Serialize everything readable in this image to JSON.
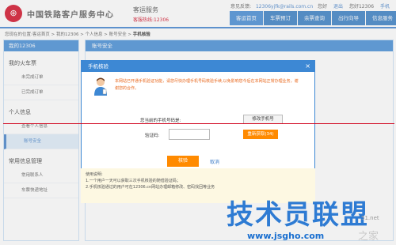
{
  "header": {
    "logo_char": "⊕",
    "brand": "中国铁路客户服务中心",
    "sub_title": "客运服务",
    "hotline": "客服热线:12306",
    "feedback_label": "意见反馈:",
    "email": "12306yjfk@rails.com.cn",
    "welcome": "您好",
    "logout": "退出",
    "greeting_suffix": "您好12306",
    "mobile": "手机"
  },
  "nav": [
    "客运首页",
    "车票预订",
    "余票查询",
    "出行向导",
    "信息服务"
  ],
  "breadcrumb": {
    "prefix": "您现在的位置:客运首页 > 我的12306 > 个人信息 > 账号安全 > ",
    "current": "手机核验"
  },
  "sidebar": {
    "title": "我的12306",
    "groups": [
      {
        "label": "我的火车票",
        "items": [
          {
            "label": "未完成订单"
          },
          {
            "label": "已完成订单"
          }
        ]
      },
      {
        "label": "个人信息",
        "items": [
          {
            "label": "查看个人信息"
          },
          {
            "label": "账号安全"
          }
        ]
      },
      {
        "label": "常用信息管理",
        "items": [
          {
            "label": "常用联系人"
          },
          {
            "label": "车票快递地址"
          }
        ]
      }
    ]
  },
  "main": {
    "title": "账号安全"
  },
  "dialog": {
    "title": "手机核验",
    "close": "×",
    "notice": "本网站已开通手机验证功能，请您尽快办理手机号码核验手续,以免影响您今后在本网站正常办理业务，谢谢您的合作。",
    "phone_label": "您当前的手机号码是:",
    "phone_value": "",
    "modify_button": "修改手机号",
    "code_label": "验证码:",
    "code_value": "",
    "resend_button": "重新获取(34)",
    "confirm_button": "核验",
    "cancel_link": "取消"
  },
  "help": {
    "title": "使用说明:",
    "lines": [
      "1.一个用户一天可以获取三次手机核验的随借验证码；",
      "2.手机核验通过的用户可在12306.cn网站办理邮箱修改、密码找回等业务"
    ]
  },
  "watermark": {
    "text": "技术员联盟",
    "url": "www.jsgho.com",
    "corner1": "51.net",
    "corner2": "之家"
  }
}
